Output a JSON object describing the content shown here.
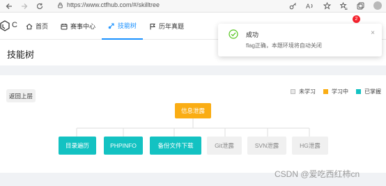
{
  "browser": {
    "url": "https://www.ctfhub.com/#/skilltree",
    "icons": [
      "back-icon",
      "forward-icon",
      "refresh-icon",
      "lock-icon",
      "key-icon",
      "read-aloud-icon",
      "favorites-add-icon",
      "favorites-icon",
      "collections-icon",
      "profile-avatar"
    ]
  },
  "header": {
    "logo_text": "C",
    "menu": [
      {
        "label": "首页",
        "icon": "home-icon"
      },
      {
        "label": "赛事中心",
        "icon": "event-icon"
      },
      {
        "label": "技能树",
        "icon": "skill-tree-icon"
      },
      {
        "label": "历年真题",
        "icon": "flag-icon"
      }
    ],
    "active_index": 2,
    "notification_count": "2"
  },
  "page": {
    "title": "技能树",
    "back_label": "返回上层"
  },
  "legend": [
    {
      "label": "未学习",
      "color": "#e8e8e8"
    },
    {
      "label": "学习中",
      "color": "#faad14"
    },
    {
      "label": "已掌握",
      "color": "#13c2c2"
    }
  ],
  "tree": {
    "root": {
      "label": "信息泄露",
      "status": "learning"
    },
    "children": [
      {
        "label": "目录遍历",
        "status": "learned"
      },
      {
        "label": "PHPINFO",
        "status": "learned"
      },
      {
        "label": "备份文件下载",
        "status": "learned"
      },
      {
        "label": "Git泄露",
        "status": "none"
      },
      {
        "label": "SVN泄露",
        "status": "none"
      },
      {
        "label": "HG泄露",
        "status": "none"
      }
    ]
  },
  "toast": {
    "title": "成功",
    "message": "flag正确，本题环境将自动关闭",
    "close": "×"
  },
  "watermark": "CSDN @爱吃西红柿cn",
  "colors": {
    "primary": "#1890ff",
    "learned": "#13c2c2",
    "learning": "#faad14",
    "success": "#52c41a"
  }
}
